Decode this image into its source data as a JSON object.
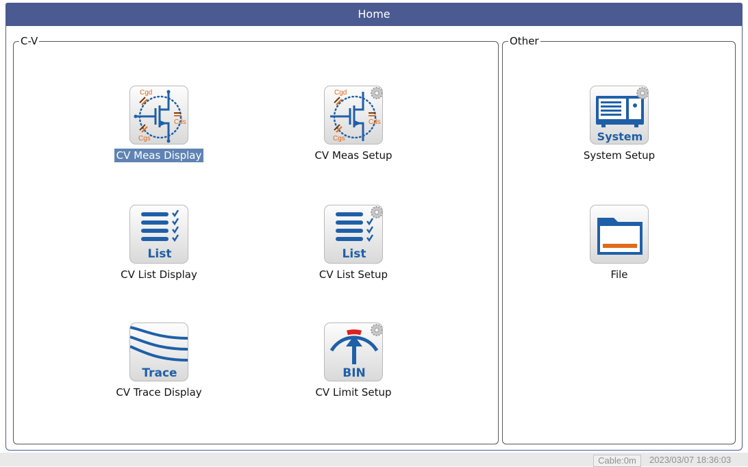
{
  "window": {
    "title": "Home"
  },
  "groups": {
    "cv": {
      "label": "C-V",
      "tiles": [
        {
          "label": "CV Meas Display",
          "icon": "cv-meas-icon",
          "selected": true
        },
        {
          "label": "CV Meas Setup",
          "icon": "cv-meas-setup-icon"
        },
        {
          "label": "CV List Display",
          "icon": "list-icon",
          "icon_text": "List"
        },
        {
          "label": "CV List Setup",
          "icon": "list-setup-icon",
          "icon_text": "List"
        },
        {
          "label": "CV Trace Display",
          "icon": "trace-icon",
          "icon_text": "Trace"
        },
        {
          "label": "CV Limit Setup",
          "icon": "bin-limit-icon",
          "icon_text": "BIN"
        }
      ]
    },
    "other": {
      "label": "Other",
      "tiles": [
        {
          "label": "System Setup",
          "icon": "system-setup-icon",
          "icon_text": "System"
        },
        {
          "label": "File",
          "icon": "folder-icon"
        }
      ]
    }
  },
  "cap_labels": {
    "cgd": "Cgd",
    "cds": "Cds",
    "cgs": "Cgs"
  },
  "status": {
    "cable": "Cable:0m",
    "datetime": "2023/03/07 18:36:03"
  },
  "colors": {
    "titlebar": "#4b5a91",
    "icon_blue": "#1f5fa8",
    "selected": "#5f83b3",
    "accent_orange": "#e06a1a",
    "accent_red": "#e02020"
  }
}
